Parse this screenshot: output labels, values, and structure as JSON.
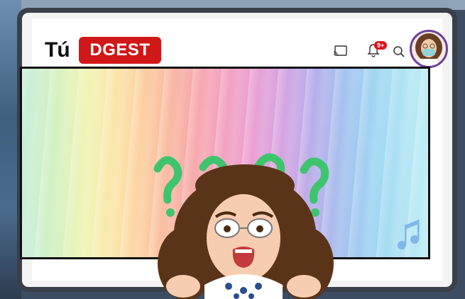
{
  "header": {
    "logo_prefix": "Tú",
    "logo_badge": "DGEST",
    "notification_count": "9+"
  },
  "icons": {
    "cast": "cast-icon",
    "notifications": "bell-icon",
    "search": "search-icon",
    "avatar": "avatar-icon"
  },
  "colors": {
    "badge_red": "#d01818",
    "avatar_ring": "#6b3fa0",
    "frame": "#3a3f48"
  }
}
